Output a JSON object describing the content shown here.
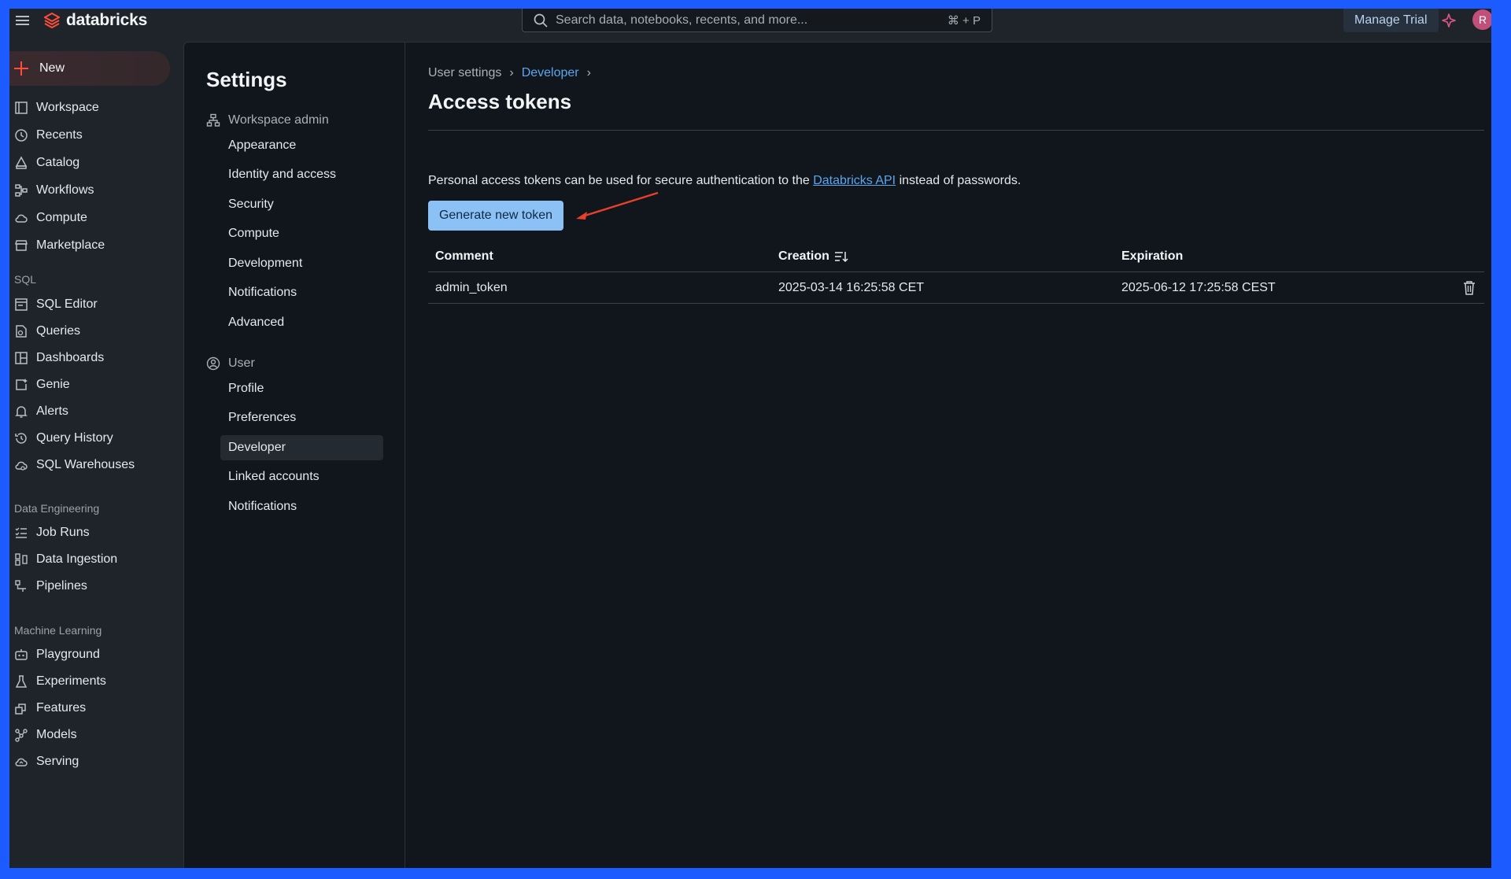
{
  "topbar": {
    "brand": "databricks",
    "search_placeholder": "Search data, notebooks, recents, and more...",
    "search_shortcut": "⌘ + P",
    "manage_trial": "Manage Trial",
    "avatar_initial": "R"
  },
  "leftnav": {
    "new_label": "New",
    "items_main": [
      "Workspace",
      "Recents",
      "Catalog",
      "Workflows",
      "Compute",
      "Marketplace"
    ],
    "section_sql": "SQL",
    "items_sql": [
      "SQL Editor",
      "Queries",
      "Dashboards",
      "Genie",
      "Alerts",
      "Query History",
      "SQL Warehouses"
    ],
    "section_de": "Data Engineering",
    "items_de": [
      "Job Runs",
      "Data Ingestion",
      "Pipelines"
    ],
    "section_ml": "Machine Learning",
    "items_ml": [
      "Playground",
      "Experiments",
      "Features",
      "Models",
      "Serving"
    ]
  },
  "settings": {
    "title": "Settings",
    "group_admin": "Workspace admin",
    "admin_items": [
      "Appearance",
      "Identity and access",
      "Security",
      "Compute",
      "Development",
      "Notifications",
      "Advanced"
    ],
    "group_user": "User",
    "user_items": [
      "Profile",
      "Preferences",
      "Developer",
      "Linked accounts",
      "Notifications"
    ]
  },
  "content": {
    "breadcrumb_1": "User settings",
    "breadcrumb_2": "Developer",
    "title": "Access tokens",
    "desc_before": "Personal access tokens can be used for secure authentication to the ",
    "desc_link": "Databricks API",
    "desc_after": " instead of passwords.",
    "generate_button": "Generate new token",
    "columns": [
      "Comment",
      "Creation",
      "Expiration"
    ],
    "rows": [
      {
        "comment": "admin_token",
        "creation": "2025-03-14 16:25:58 CET",
        "expiration": "2025-06-12 17:25:58 CEST"
      }
    ]
  },
  "colors": {
    "frame": "#1b5bff",
    "accent_red": "#ff4d39",
    "link_blue": "#5aa6f0",
    "button_blue": "#8cc1f5"
  }
}
